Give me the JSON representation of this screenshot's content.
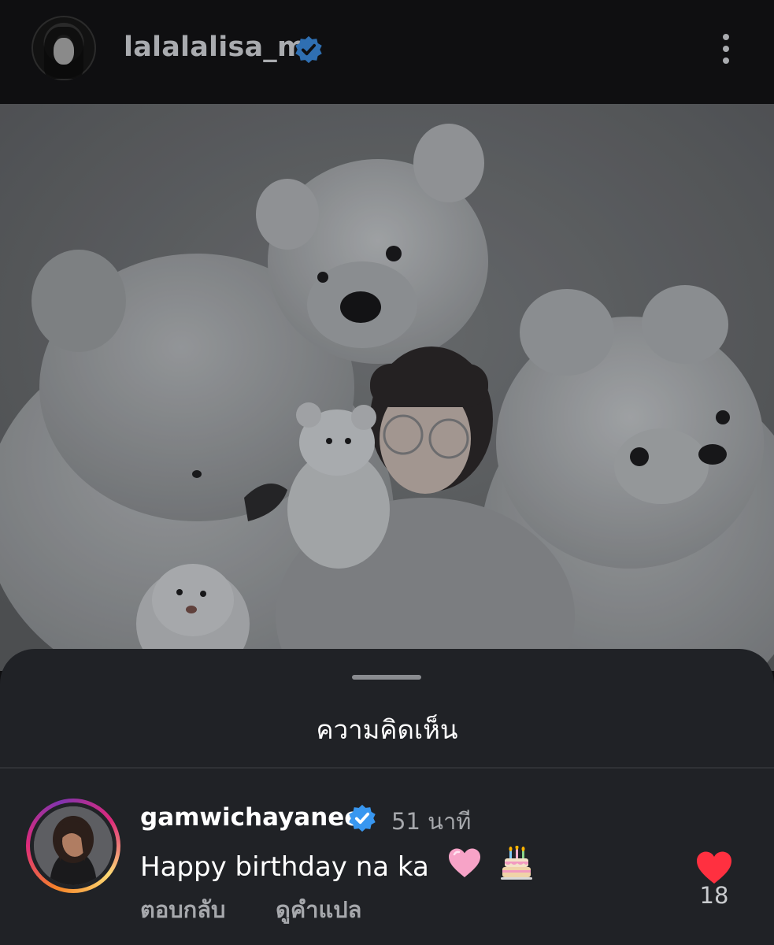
{
  "header": {
    "username": "lalalalisa_m",
    "verified_icon": "verified-badge-icon",
    "more_icon": "more-vertical-icon"
  },
  "post": {
    "image": "photo of a woman in glasses surrounded by white teddy bears"
  },
  "comments_sheet": {
    "title": "ความคิดเห็น",
    "comments": [
      {
        "username": "gamwichayanee",
        "time": "51 นาที",
        "text": "Happy birthday na ka",
        "emojis": [
          "pink-heart",
          "birthday-cake"
        ],
        "reply_label": "ตอบกลับ",
        "translate_label": "ดูคำแปล",
        "likes": "18",
        "liked": true
      }
    ]
  },
  "colors": {
    "header_bg": "#0f0f11",
    "sheet_bg": "#202226",
    "verified_blue": "#3897f0",
    "like_red": "#ff3040",
    "muted_text": "#a6a8ac"
  }
}
